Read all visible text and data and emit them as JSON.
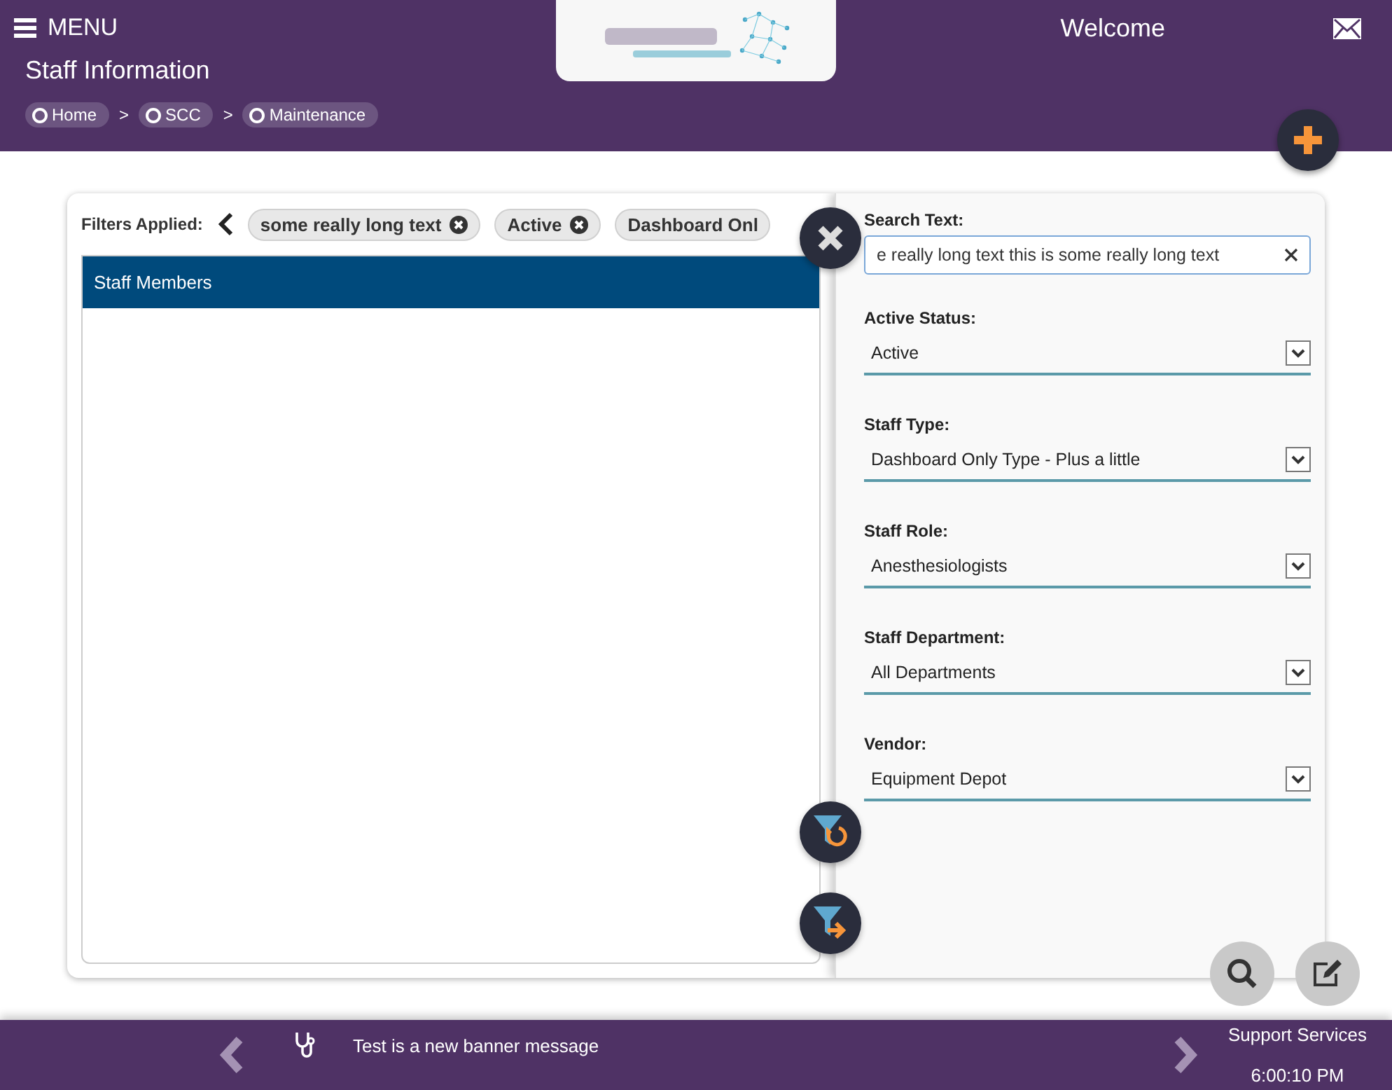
{
  "header": {
    "menu_label": "MENU",
    "title": "Staff Information",
    "breadcrumbs": [
      "Home",
      "SCC",
      "Maintenance"
    ],
    "breadcrumb_separator": ">",
    "welcome": "Welcome"
  },
  "filters_applied": {
    "label": "Filters Applied:",
    "chips": [
      "some really long text",
      "Active",
      "Dashboard Onl"
    ]
  },
  "table": {
    "title": "Staff Members"
  },
  "filter_panel": {
    "search": {
      "label": "Search Text:",
      "value": "e really long text this is some really long text"
    },
    "selects": [
      {
        "label": "Active Status:",
        "value": "Active"
      },
      {
        "label": "Staff Type:",
        "value": "Dashboard Only Type - Plus a little"
      },
      {
        "label": "Staff Role:",
        "value": "Anesthesiologists"
      },
      {
        "label": "Staff Department:",
        "value": "All Departments"
      },
      {
        "label": "Vendor:",
        "value": "Equipment Depot"
      }
    ]
  },
  "footer": {
    "banner": "Test is a new banner message",
    "support": "Support Services",
    "time": "6:00:10 PM"
  }
}
